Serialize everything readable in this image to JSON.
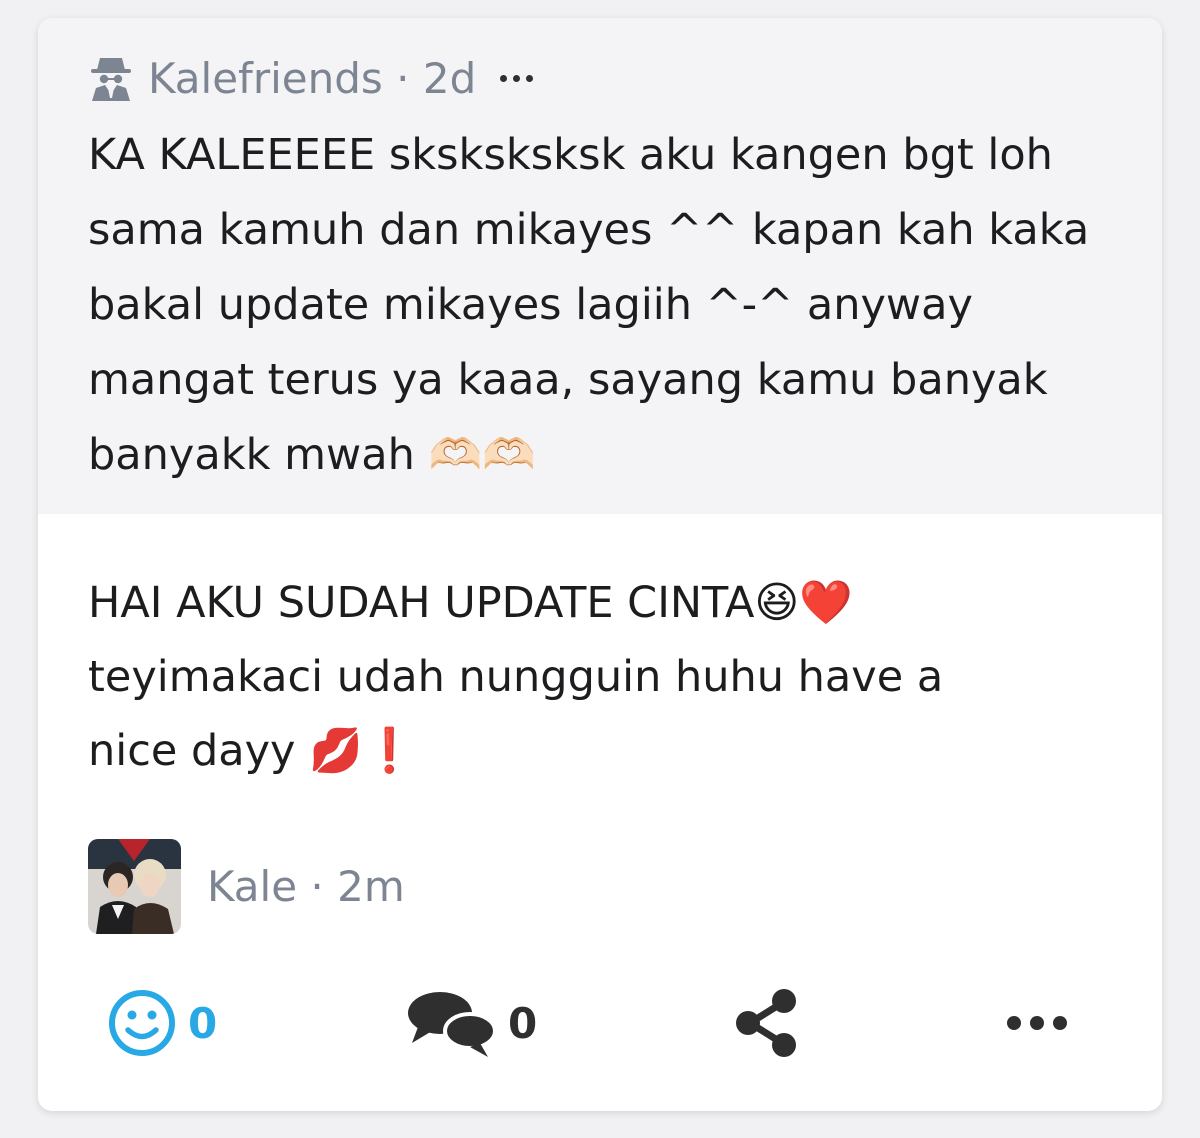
{
  "question": {
    "author": "Kalefriends",
    "separator": "·",
    "time": "2d",
    "author_icon": "anonymous-spy-icon",
    "more_icon": "ellipsis-icon",
    "text": "KA KALEEEEE sksksksksk aku kangen bgt loh sama kamuh dan mikayes ^^ kapan kah kaka bakal update mikayes lagiih ^-^ anyway mangat terus ya kaaa, sayang kamu banyak banyakk mwah 🫶🏻🫶🏻"
  },
  "answer": {
    "line1": "HAI AKU SUDAH UPDATE CINTA😆❤️",
    "line2": "teyimakaci udah nungguin huhu have a",
    "line3": "nice dayy 💋❗"
  },
  "responder": {
    "name": "Kale",
    "separator": "·",
    "time": "2m"
  },
  "actions": {
    "like_count": "0",
    "comment_count": "0",
    "like_icon": "smiley-icon",
    "comment_icon": "chat-bubbles-icon",
    "share_icon": "share-icon",
    "more_icon": "ellipsis-icon"
  },
  "colors": {
    "background": "#f1f1f3",
    "question_bg": "#f4f4f6",
    "meta_gray": "#7c8591",
    "accent_blue": "#29a8e6",
    "text": "#1d1d1f"
  }
}
